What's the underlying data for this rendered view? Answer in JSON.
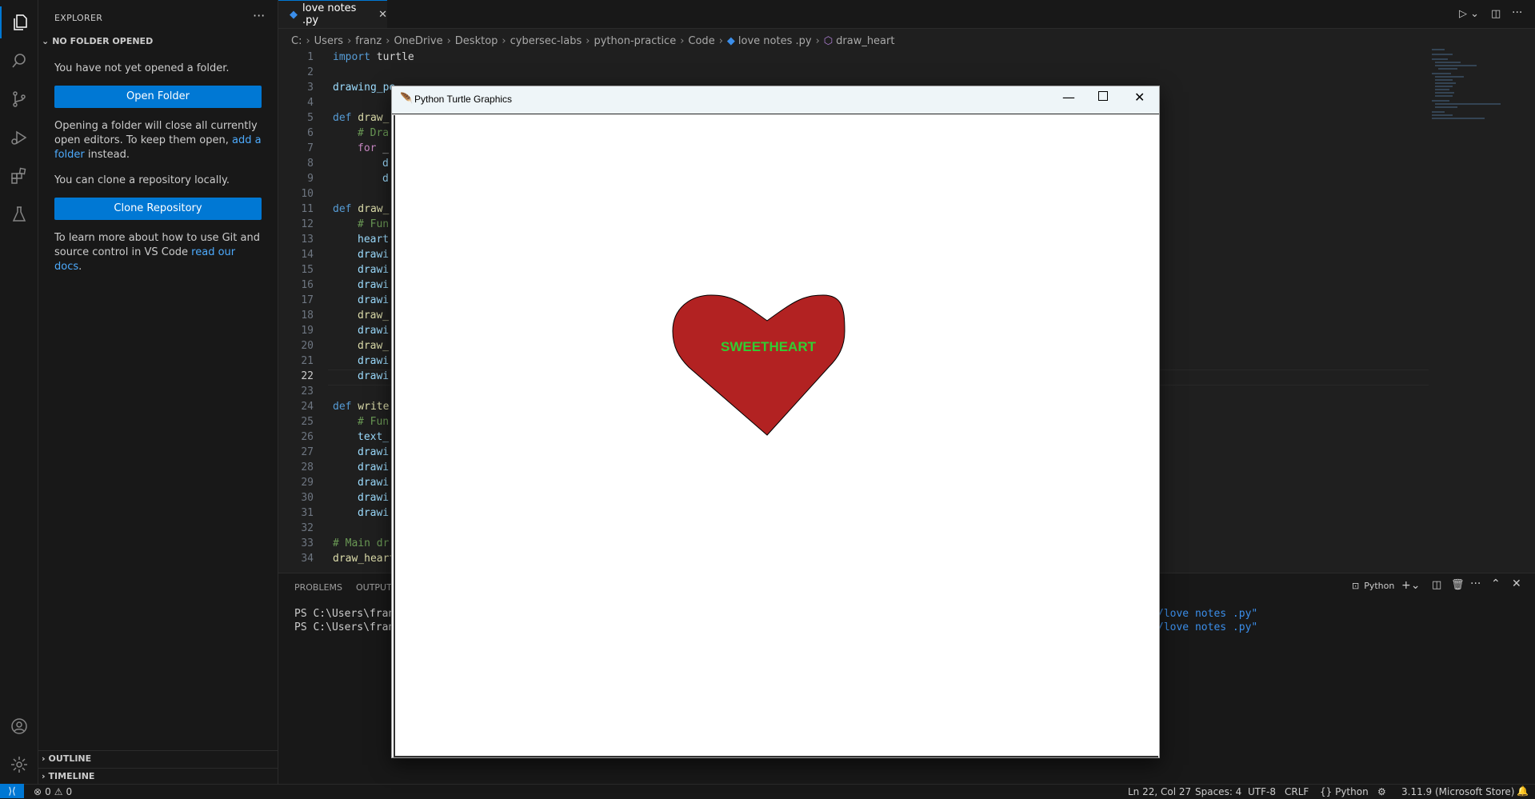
{
  "sidebar": {
    "title": "EXPLORER",
    "more": "···",
    "section": "NO FOLDER OPENED",
    "msg1": "You have not yet opened a folder.",
    "open_folder": "Open Folder",
    "msg2a": "Opening a folder will close all currently open editors. To keep them open, ",
    "msg2_link": "add a folder",
    "msg2b": " instead.",
    "msg3": "You can clone a repository locally.",
    "clone_repo": "Clone Repository",
    "msg4a": "To learn more about how to use Git and source control in VS Code ",
    "msg4_link": "read our docs",
    "msg4b": ".",
    "outline": "OUTLINE",
    "timeline": "TIMELINE"
  },
  "editor": {
    "tab_label": "love notes .py",
    "breadcrumb": [
      "C:",
      "Users",
      "franz",
      "OneDrive",
      "Desktop",
      "cybersec-labs",
      "python-practice",
      "Code",
      "love notes .py",
      "draw_heart"
    ],
    "line_numbers": [
      "1",
      "2",
      "3",
      "4",
      "5",
      "6",
      "7",
      "8",
      "9",
      "10",
      "11",
      "12",
      "13",
      "14",
      "15",
      "16",
      "17",
      "18",
      "19",
      "20",
      "21",
      "22",
      "23",
      "24",
      "25",
      "26",
      "27",
      "28",
      "29",
      "30",
      "31",
      "32",
      "33",
      "34"
    ],
    "lines": {
      "l1_kw": "import",
      "l1_rest": " turtle",
      "l3": "drawing_pe",
      "l5_kw": "def",
      "l5_rest": " draw_",
      "l6": "# Dra",
      "l7_kw": "for",
      "l7_rest": " _",
      "l8": "d",
      "l9": "d",
      "l11_kw": "def",
      "l11_rest": " draw_",
      "l12": "# Fun",
      "l13": "heart",
      "l14": "drawi",
      "l15": "drawi",
      "l16": "drawi",
      "l17": "drawi",
      "l18": "draw_",
      "l19": "drawi",
      "l20": "draw_",
      "l21": "drawi",
      "l22": "drawi",
      "l24_kw": "def",
      "l24_rest": " write",
      "l25": "# Fun",
      "l26": "text_",
      "l27": "drawi",
      "l28": "drawi",
      "l29": "drawi",
      "l30": "drawi",
      "l31": "drawi",
      "l33": "# Main dr",
      "l34": "draw_heart"
    }
  },
  "panel": {
    "tab_problems": "PROBLEMS",
    "tab_output": "OUTPUT",
    "terminal_name": "Python",
    "term_line1": "PS C:\\Users\\franz",
    "term_line2": "PS C:\\Users\\franz",
    "term_tail1": "/love notes .py\"",
    "term_tail2": "/love notes .py\""
  },
  "status": {
    "errors": "0",
    "warnings": "0",
    "position": "Ln 22, Col 27",
    "spaces": "Spaces: 4",
    "encoding": "UTF-8",
    "eol": "CRLF",
    "language": "{} Python",
    "interpreter": "3.11.9 (Microsoft Store)"
  },
  "turtle_window": {
    "title": "Python Turtle Graphics",
    "heart_text": "SWEETHEART",
    "heart_color": "#b22222",
    "text_color": "#32cd32"
  },
  "colors": {
    "accent": "#0078d4",
    "link": "#4daafc"
  }
}
